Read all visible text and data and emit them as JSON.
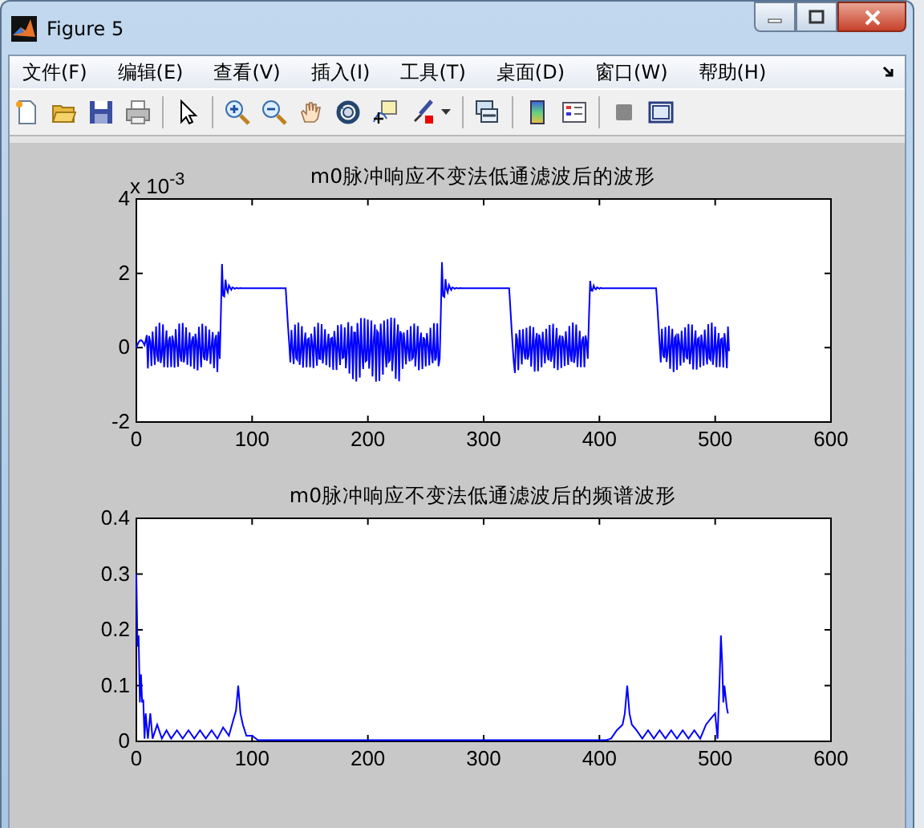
{
  "window": {
    "title": "Figure 5"
  },
  "menu": [
    {
      "label": "文件(F)"
    },
    {
      "label": "编辑(E)"
    },
    {
      "label": "查看(V)"
    },
    {
      "label": "插入(I)"
    },
    {
      "label": "工具(T)"
    },
    {
      "label": "桌面(D)"
    },
    {
      "label": "窗口(W)"
    },
    {
      "label": "帮助(H)"
    }
  ],
  "plots": [
    {
      "kind": "time",
      "title": "m0脉冲响应不变法低通滤波后的波形",
      "scale": "x 10$^{-3}$",
      "xticks": [
        "0",
        "100",
        "200",
        "300",
        "400",
        "500",
        "600"
      ],
      "yticks": [
        "4",
        "2",
        "0",
        "-2"
      ]
    },
    {
      "kind": "spectrum",
      "chart_data": {
        "type": "line",
        "title": "m0脉冲响应不变法低通滤波后的频谱波形",
        "x": [
          0,
          1,
          2,
          3,
          4,
          5,
          6,
          7,
          8,
          10,
          12,
          14,
          18,
          22,
          26,
          30,
          35,
          40,
          45,
          50,
          55,
          60,
          65,
          70,
          75,
          80,
          84,
          86,
          88,
          90,
          92,
          95,
          100,
          105,
          405,
          410,
          415,
          420,
          422,
          424,
          426,
          428,
          432,
          437,
          442,
          447,
          452,
          457,
          462,
          467,
          472,
          477,
          482,
          487,
          492,
          496,
          500,
          502,
          504,
          505,
          506,
          507,
          508,
          510,
          511
        ],
        "values": [
          0.3,
          0.17,
          0.19,
          0.07,
          0.12,
          0.07,
          0.075,
          0.005,
          0.05,
          0.005,
          0.05,
          0.005,
          0.03,
          0.005,
          0.02,
          0.005,
          0.02,
          0.005,
          0.02,
          0.005,
          0.02,
          0.005,
          0.02,
          0.005,
          0.025,
          0.01,
          0.04,
          0.055,
          0.1,
          0.05,
          0.03,
          0.01,
          0.01,
          0.002,
          0.002,
          0.005,
          0.02,
          0.03,
          0.05,
          0.1,
          0.05,
          0.03,
          0.02,
          0.005,
          0.02,
          0.005,
          0.02,
          0.005,
          0.02,
          0.005,
          0.02,
          0.005,
          0.02,
          0.005,
          0.03,
          0.04,
          0.05,
          0.005,
          0.12,
          0.19,
          0.14,
          0.07,
          0.1,
          0.06,
          0.05
        ],
        "xlim": [
          0,
          600
        ],
        "ylim": [
          0,
          0.4
        ],
        "xticks": [
          0,
          100,
          200,
          300,
          400,
          500,
          600
        ],
        "yticks": [
          0,
          0.1,
          0.2,
          0.3,
          0.4
        ]
      }
    }
  ]
}
